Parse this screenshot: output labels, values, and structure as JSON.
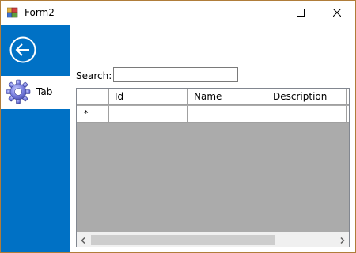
{
  "window": {
    "title": "Form2",
    "minimize_icon": "minimize-icon",
    "maximize_icon": "maximize-icon",
    "close_icon": "close-icon"
  },
  "sidebar": {
    "color": "#0071c5",
    "back_icon": "back-arrow-icon",
    "items": [
      {
        "label": "Tab",
        "icon": "gear-icon",
        "selected": true
      }
    ]
  },
  "search": {
    "label": "Search:",
    "value": ""
  },
  "grid": {
    "columns": [
      "Id",
      "Name",
      "Description"
    ],
    "new_row_marker": "*",
    "rows": [],
    "background": "#ababab"
  }
}
